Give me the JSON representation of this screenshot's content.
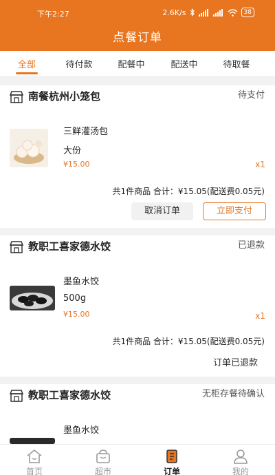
{
  "status_bar": {
    "time": "下午2:27",
    "speed": "2.6K/s",
    "battery": "38"
  },
  "header": {
    "title": "点餐订单"
  },
  "tabs": [
    {
      "label": "全部",
      "active": true
    },
    {
      "label": "待付款"
    },
    {
      "label": "配餐中"
    },
    {
      "label": "配送中"
    },
    {
      "label": "待取餐"
    }
  ],
  "orders": [
    {
      "shop": "南餐杭州小笼包",
      "status": "待支付",
      "item": {
        "name": "三鲜灌汤包",
        "spec": "大份",
        "price": "¥15.00",
        "qty": "x1"
      },
      "summary": "共1件商品 合计：¥15.05(配送费0.05元)",
      "actions": {
        "cancel": "取消订单",
        "pay": "立即支付"
      }
    },
    {
      "shop": "教职工喜家德水饺",
      "status": "已退款",
      "item": {
        "name": "墨鱼水饺",
        "spec": "500g",
        "price": "¥15.00",
        "qty": "x1"
      },
      "summary": "共1件商品 合计：¥15.05(配送费0.05元)",
      "refund_text": "订单已退款"
    },
    {
      "shop": "教职工喜家德水饺",
      "status": "无柜存餐待确认",
      "item": {
        "name": "墨鱼水饺"
      }
    }
  ],
  "bottom_nav": [
    {
      "label": "首页",
      "icon": "home-icon"
    },
    {
      "label": "超市",
      "icon": "basket-icon"
    },
    {
      "label": "订单",
      "icon": "order-icon",
      "active": true
    },
    {
      "label": "我的",
      "icon": "user-icon"
    }
  ],
  "colors": {
    "accent": "#e8751f",
    "background": "#f2f2f2"
  }
}
